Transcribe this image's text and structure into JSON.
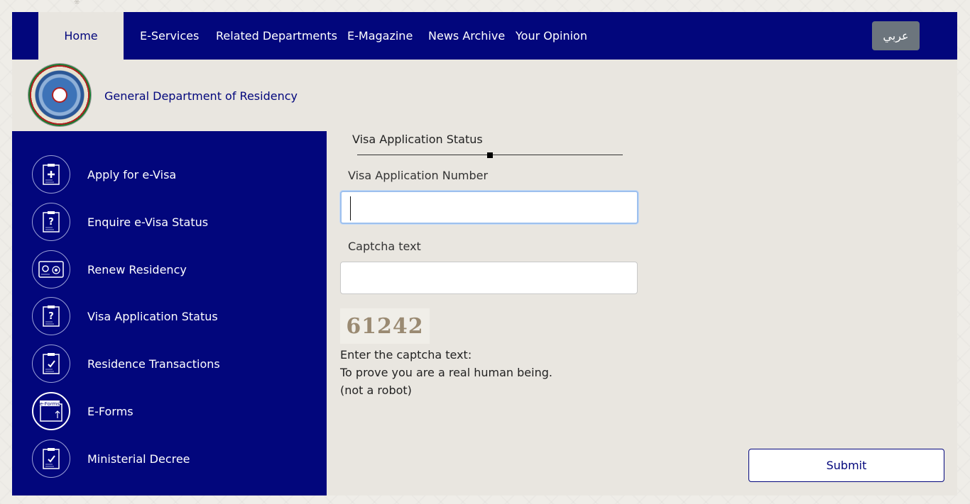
{
  "nav": {
    "home": "Home",
    "items": [
      "E-Services",
      "Related Departments",
      "E-Magazine",
      "News Archive",
      "Your Opinion"
    ],
    "language_button": "عربي"
  },
  "header": {
    "title": "General Department of Residency"
  },
  "sidebar": {
    "items": [
      {
        "label": "Apply for e-Visa",
        "icon": "visa-add-icon"
      },
      {
        "label": "Enquire e-Visa Status",
        "icon": "visa-question-icon"
      },
      {
        "label": "Renew Residency",
        "icon": "id-card-icon"
      },
      {
        "label": "Visa Application Status",
        "icon": "visa-question-icon"
      },
      {
        "label": "Residence Transactions",
        "icon": "document-check-icon"
      },
      {
        "label": "E-Forms",
        "icon": "eforms-icon",
        "icon_text": "e-Forms"
      },
      {
        "label": "Ministerial Decree",
        "icon": "document-check-icon"
      }
    ]
  },
  "form": {
    "heading": "Visa Application Status",
    "visa_number_label": "Visa Application Number",
    "visa_number_value": "",
    "captcha_label": "Captcha text",
    "captcha_value": "",
    "captcha_image_text": "61242",
    "help_lines": [
      "Enter the captcha text:",
      "To prove you are a real human being.",
      "(not a robot)"
    ],
    "submit_label": "Submit"
  },
  "colors": {
    "primary": "#02067c",
    "background": "#e9e6e0",
    "language_button": "#6c757d"
  }
}
